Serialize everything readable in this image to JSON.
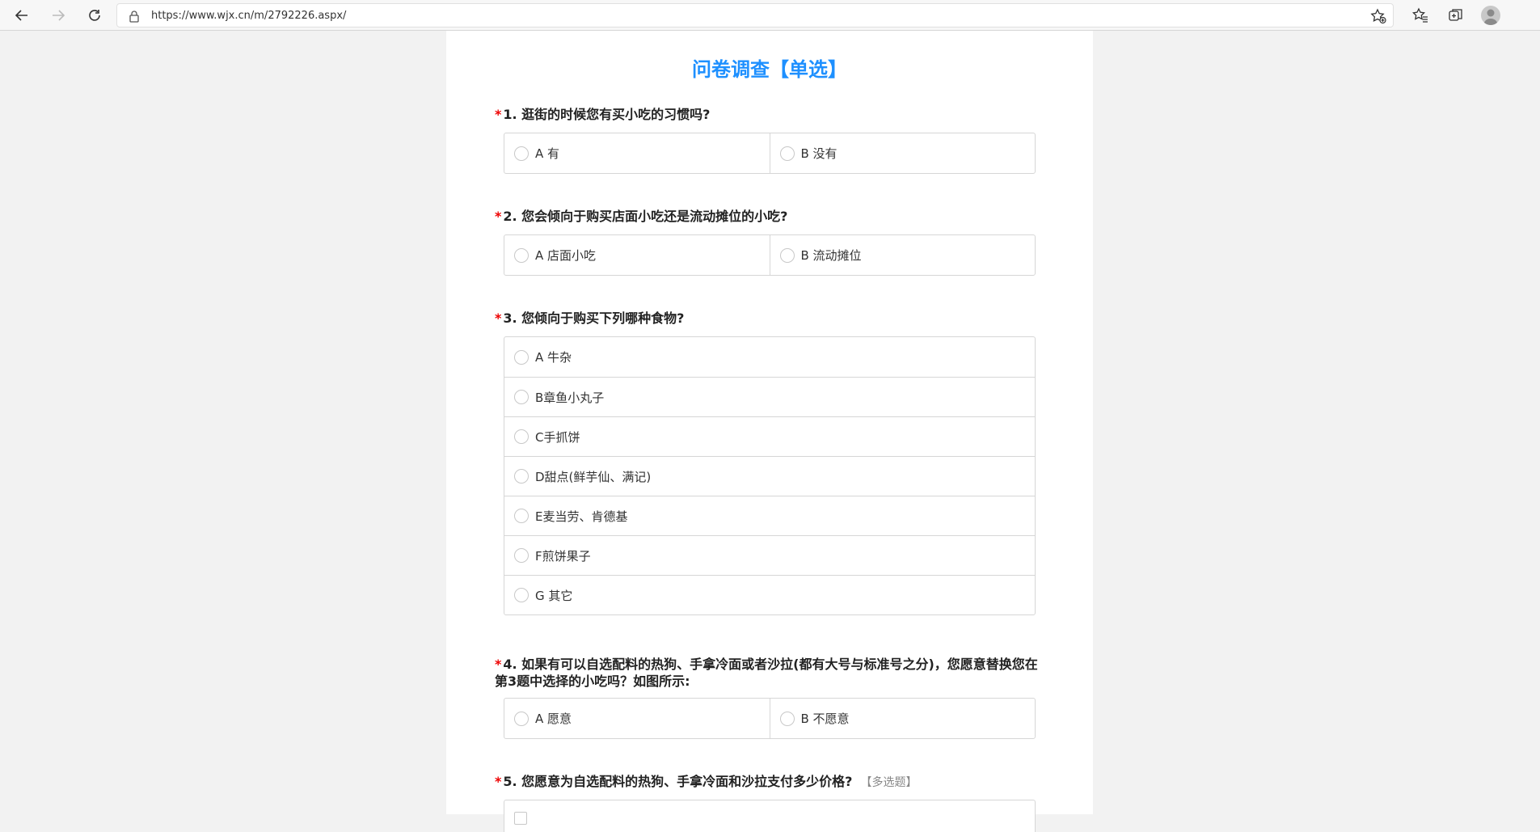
{
  "browser": {
    "url": "https://www.wjx.cn/m/2792226.aspx/"
  },
  "survey": {
    "title": "问卷调查【单选】",
    "questions": [
      {
        "number": "1. 逛街的时候您有买小吃的习惯吗?",
        "options": [
          "A 有",
          "B 没有"
        ]
      },
      {
        "number": "2. 您会倾向于购买店面小吃还是流动摊位的小吃?",
        "options": [
          "A 店面小吃",
          "B 流动摊位"
        ]
      },
      {
        "number": "3. 您倾向于购买下列哪种食物?",
        "options": [
          "A 牛杂",
          "B章鱼小丸子",
          "C手抓饼",
          "D甜点(鲜芋仙、满记)",
          "E麦当劳、肯德基",
          "F煎饼果子",
          "G 其它"
        ]
      },
      {
        "number": "4. 如果有可以自选配料的热狗、手拿冷面或者沙拉(都有大号与标准号之分)，您愿意替换您在第3题中选择的小吃吗？如图所示:",
        "options": [
          "A 愿意",
          "B 不愿意"
        ]
      },
      {
        "number": "5. 您愿意为自选配料的热狗、手拿冷面和沙拉支付多少价格?",
        "tag": "【多选题】"
      }
    ],
    "required_mark": "*"
  }
}
